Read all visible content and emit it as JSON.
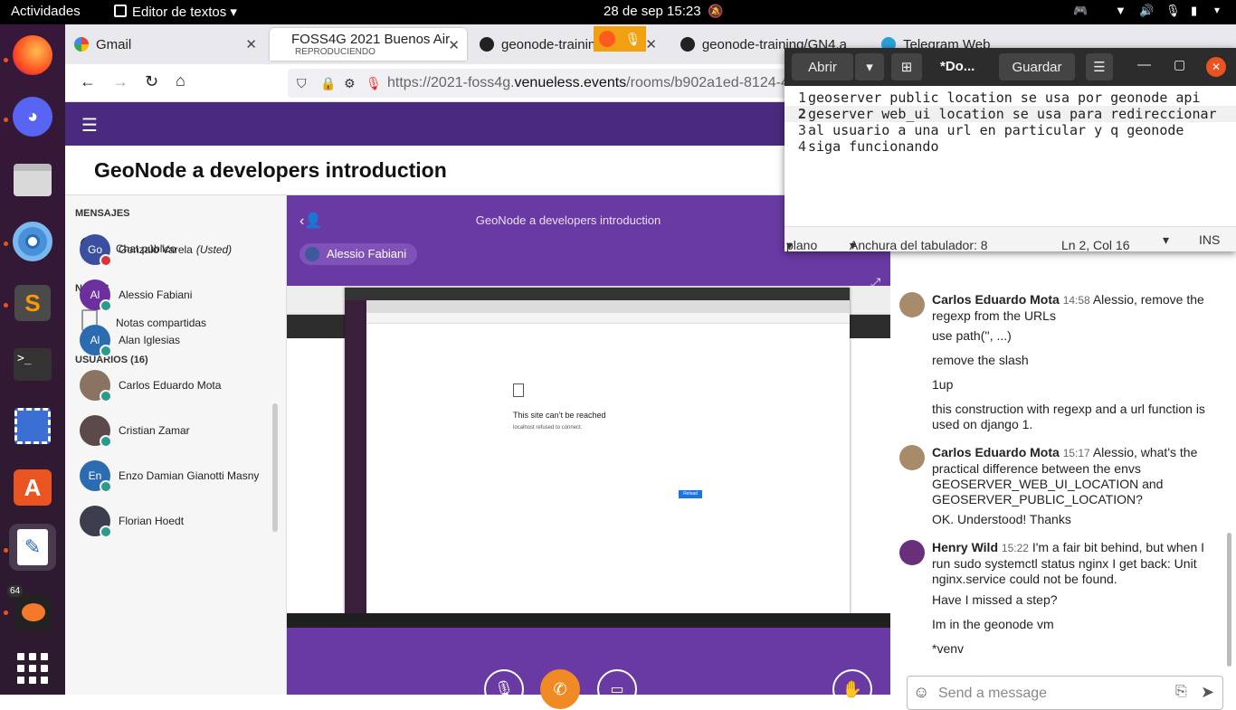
{
  "topbar": {
    "activities": "Actividades",
    "app_menu": "Editor de textos",
    "clock": "28 de sep  15:23"
  },
  "browser": {
    "tabs": [
      {
        "title": "Gmail"
      },
      {
        "title": "FOSS4G 2021 Buenos Air",
        "subtitle": "REPRODUCIENDO"
      },
      {
        "title": "geonode-trainin"
      },
      {
        "title": "geonode-training/GN4.a"
      },
      {
        "title": "Telegram Web"
      }
    ],
    "url_host": "https://2021-foss4g.",
    "url_domain": "venueless.events",
    "url_path": "/rooms/b902a1ed-8124-4"
  },
  "page": {
    "title": "GeoNode a developers introduction",
    "stage_title": "GeoNode a developers introduction",
    "speaker": "Alessio Fabiani"
  },
  "sidebar": {
    "messages_header": "MENSAJES",
    "public_chat": "Chat público",
    "notes_header": "NOTAS",
    "shared_notes": "Notas compartidas",
    "users_header": "USUARIOS (16)",
    "users": [
      {
        "initials": "Go",
        "name": "Gonzalo Varela",
        "suffix": "(Usted)",
        "color": "#3a4fa0"
      },
      {
        "initials": "Al",
        "name": "Alessio Fabiani",
        "suffix": "",
        "color": "#6b2f9e"
      },
      {
        "initials": "Al",
        "name": "Alan Iglesias",
        "suffix": "",
        "color": "#2b6cb0"
      },
      {
        "initials": "",
        "name": "Carlos Eduardo Mota",
        "suffix": "",
        "color": "#8a7360"
      },
      {
        "initials": "",
        "name": "Cristian Zamar",
        "suffix": "",
        "color": "#5c4a4a"
      },
      {
        "initials": "En",
        "name": "Enzo Damian Gianotti Masny",
        "suffix": "",
        "color": "#2b6cb0"
      },
      {
        "initials": "",
        "name": "Florian Hoedt",
        "suffix": "",
        "color": "#3d3d50"
      }
    ]
  },
  "shared_screen": {
    "error_title": "This site can’t be reached",
    "error_detail": "localhost refused to connect.",
    "reload": "Reload"
  },
  "chat": {
    "messages": [
      {
        "author": "Carlos Eduardo Mota",
        "time": "14:58",
        "text": "Alessio, remove the regexp from the URLs"
      },
      {
        "text": "use path('', ...)"
      },
      {
        "text": "remove the slash"
      },
      {
        "text": "1up"
      },
      {
        "text": "this construction with regexp and a url function is used on django 1."
      },
      {
        "author": "Carlos Eduardo Mota",
        "time": "15:17",
        "text": "Alessio, what's the practical difference between the envs GEOSERVER_WEB_UI_LOCATION and GEOSERVER_PUBLIC_LOCATION?"
      },
      {
        "text": "OK. Understood! Thanks"
      },
      {
        "author": "Henry Wild",
        "time": "15:22",
        "text": "I'm a fair bit behind, but when I run sudo systemctl status nginx I get back:  Unit nginx.service could not be found."
      },
      {
        "text": "Have I missed a step?"
      },
      {
        "text": "Im in the geonode vm"
      },
      {
        "text": "*venv"
      }
    ],
    "input_placeholder": "Send a message"
  },
  "editor": {
    "open_label": "Abrir",
    "doc_title": "*Do...",
    "save_label": "Guardar",
    "lines": [
      "geoserver public location se usa por geonode api",
      "geserver web_ui location se usa para redireccionar",
      "al usuario a una url en particular y q geonode",
      "siga funcionando"
    ],
    "line_numbers": [
      "1",
      "2",
      "3",
      "4"
    ],
    "status_syntax": "plano",
    "status_tab": "Anchura del tabulador: 8",
    "status_pos": "Ln 2, Col 16",
    "status_mode": "INS"
  },
  "dock": {
    "badge_count": "64"
  },
  "colors": {
    "purple": "#4a2a7f",
    "stage": "#6a3aa4",
    "accent_orange": "#e95420",
    "hangup": "#f08a24"
  }
}
